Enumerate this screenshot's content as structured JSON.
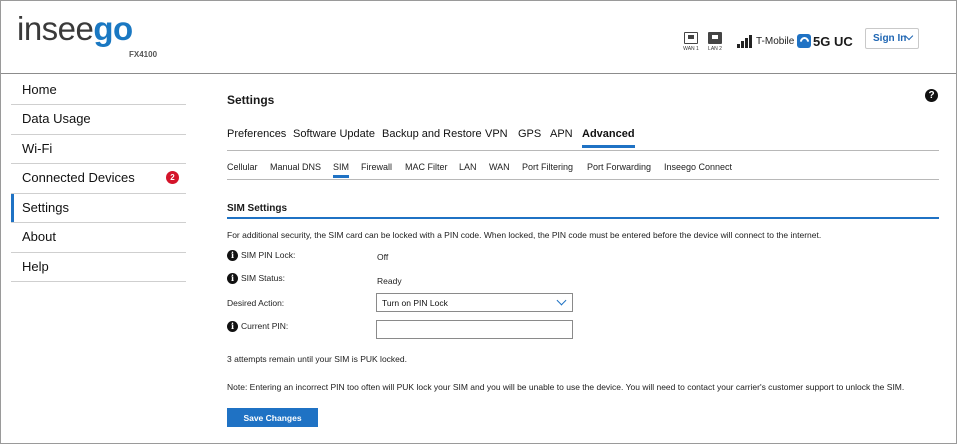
{
  "header": {
    "logo_part1": "insee",
    "logo_part2": "go",
    "model": "FX4100",
    "wan1_label": "WAN 1",
    "lan2_label": "LAN 2",
    "carrier": "T-Mobile",
    "network": "5G UC",
    "signin_label": "Sign In"
  },
  "sidebar": {
    "items": [
      {
        "label": "Home"
      },
      {
        "label": "Data Usage"
      },
      {
        "label": "Wi-Fi"
      },
      {
        "label": "Connected Devices",
        "badge": "2"
      },
      {
        "label": "Settings",
        "active": true
      },
      {
        "label": "About"
      },
      {
        "label": "Help"
      }
    ]
  },
  "main": {
    "title": "Settings",
    "help_symbol": "?",
    "tabs": [
      {
        "label": "Preferences"
      },
      {
        "label": "Software Update"
      },
      {
        "label": "Backup and Restore"
      },
      {
        "label": "VPN"
      },
      {
        "label": "GPS"
      },
      {
        "label": "APN"
      },
      {
        "label": "Advanced",
        "active": true
      }
    ],
    "subtabs": [
      {
        "label": "Cellular"
      },
      {
        "label": "Manual DNS"
      },
      {
        "label": "SIM",
        "active": true
      },
      {
        "label": "Firewall"
      },
      {
        "label": "MAC Filter"
      },
      {
        "label": "LAN"
      },
      {
        "label": "WAN"
      },
      {
        "label": "Port Filtering"
      },
      {
        "label": "Port Forwarding"
      },
      {
        "label": "Inseego Connect"
      }
    ],
    "section_title": "SIM Settings",
    "intro": "For additional security, the SIM card can be locked with a PIN code. When locked, the PIN code must be entered before the device will connect to the internet.",
    "info_symbol": "i",
    "pin_lock": {
      "label": "SIM PIN Lock:",
      "value": "Off"
    },
    "sim_status": {
      "label": "SIM Status:",
      "value": "Ready"
    },
    "desired_action": {
      "label": "Desired Action:",
      "value": "Turn on PIN Lock"
    },
    "current_pin": {
      "label": "Current PIN:",
      "value": "",
      "placeholder": ""
    },
    "attempts": "3 attempts remain until your SIM is PUK locked.",
    "note": "Note: Entering an incorrect PIN too often will PUK lock your SIM and you will be unable to use the device. You will need to contact your carrier's customer support to unlock the SIM.",
    "save_label": "Save Changes"
  },
  "colors": {
    "accent": "#1f72c4",
    "badge": "#d4142a"
  }
}
